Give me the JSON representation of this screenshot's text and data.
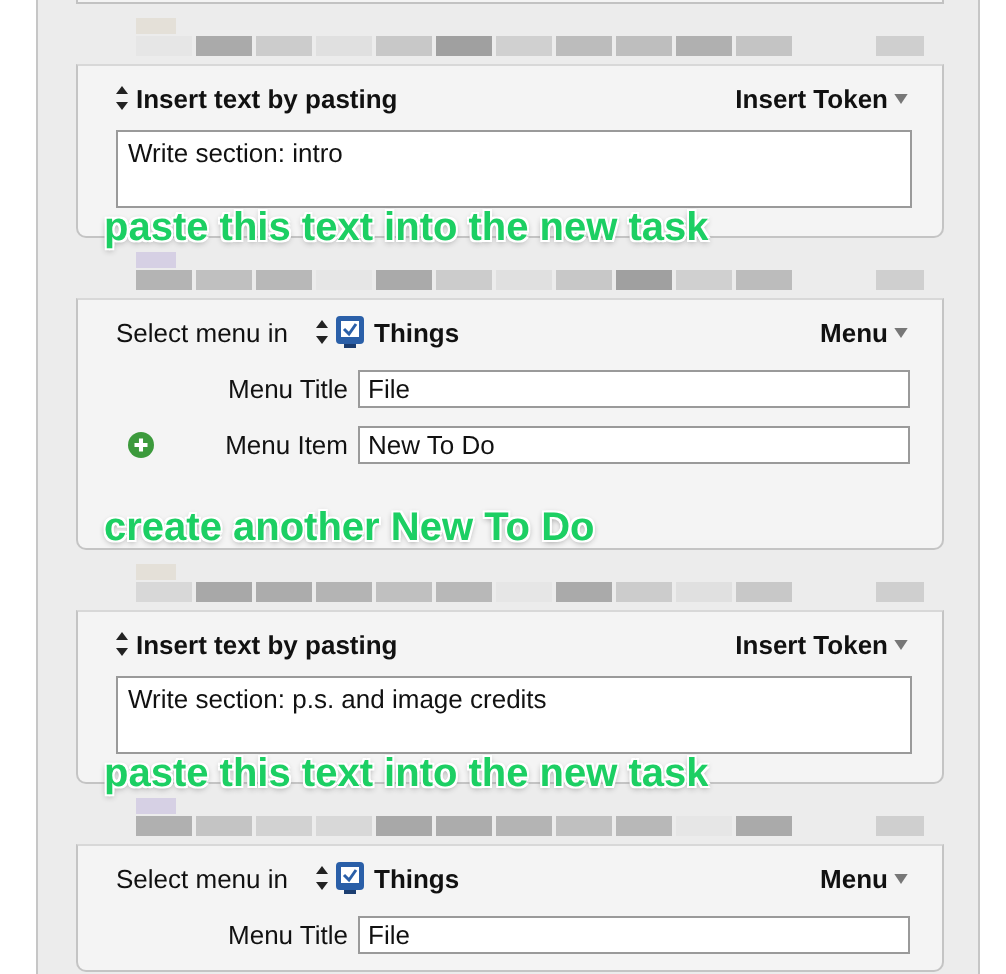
{
  "actions": [
    {
      "kind": "paste",
      "label": "Insert text by pasting",
      "menu": "Insert Token",
      "text": "Write section: intro",
      "annotation": "paste this text into the new task"
    },
    {
      "kind": "menu",
      "label": "Select menu in",
      "app": "Things",
      "menu": "Menu",
      "fields": [
        {
          "label": "Menu Title",
          "value": "File",
          "addable": false
        },
        {
          "label": "Menu Item",
          "value": "New To Do",
          "addable": true
        }
      ],
      "annotation": "create another New To Do"
    },
    {
      "kind": "paste",
      "label": "Insert text by pasting",
      "menu": "Insert Token",
      "text": "Write section: p.s. and image credits",
      "annotation": "paste this text into the new task"
    },
    {
      "kind": "menu",
      "label": "Select menu in",
      "app": "Things",
      "menu": "Menu",
      "fields": [
        {
          "label": "Menu Title",
          "value": "File",
          "addable": false
        }
      ]
    }
  ]
}
